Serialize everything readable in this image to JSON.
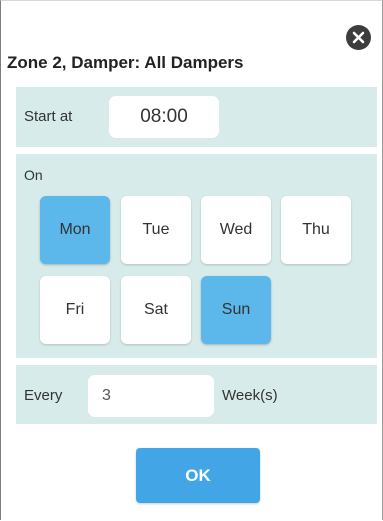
{
  "dialog": {
    "title": "Zone 2, Damper: All Dampers",
    "close_icon": "close-icon"
  },
  "start": {
    "label": "Start at",
    "time_value": "08:00"
  },
  "days": {
    "label": "On",
    "items": [
      {
        "label": "Mon",
        "selected": true
      },
      {
        "label": "Tue",
        "selected": false
      },
      {
        "label": "Wed",
        "selected": false
      },
      {
        "label": "Thu",
        "selected": false
      },
      {
        "label": "Fri",
        "selected": false
      },
      {
        "label": "Sat",
        "selected": false
      },
      {
        "label": "Sun",
        "selected": true
      }
    ]
  },
  "repeat": {
    "label": "Every",
    "value": "3",
    "unit": "Week(s)"
  },
  "actions": {
    "ok_label": "OK"
  },
  "colors": {
    "panel_bg": "#d7ebea",
    "selected_day": "#5cb7ea",
    "ok_button": "#42a6e6",
    "close_button": "#3d3d3d"
  }
}
